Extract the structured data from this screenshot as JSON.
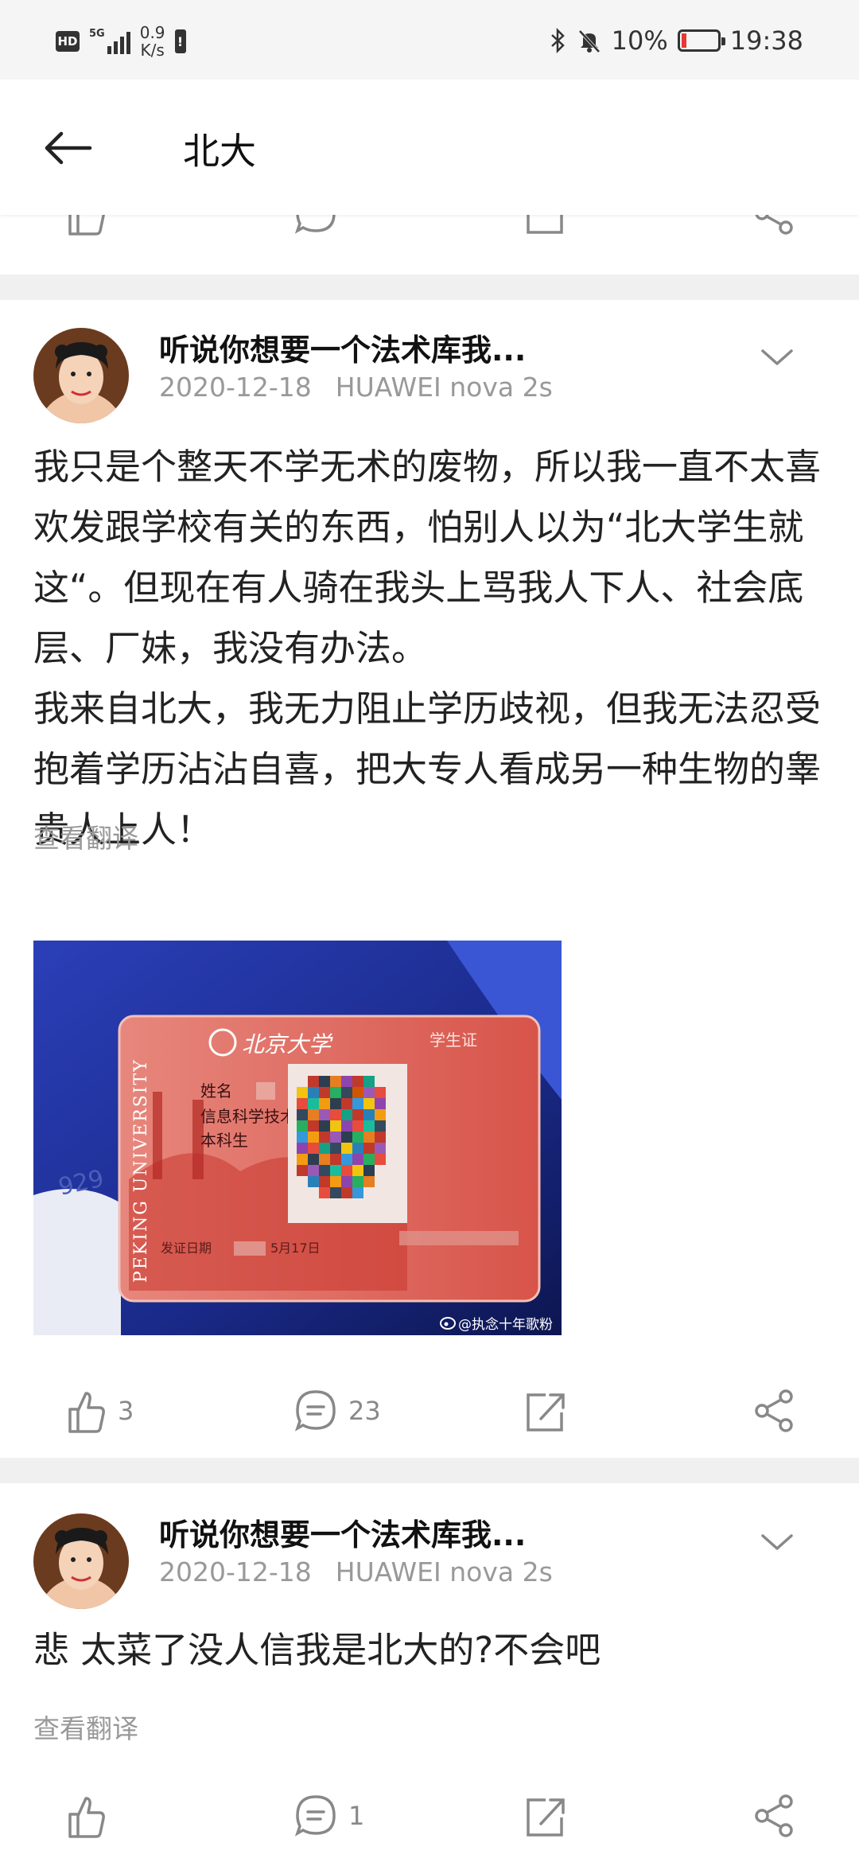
{
  "status_bar": {
    "hd": "HD",
    "network": "5G",
    "speed_value": "0.9",
    "speed_unit": "K/s",
    "battery_percent": "10%",
    "time": "19:38"
  },
  "app_bar": {
    "title": "北大"
  },
  "posts": [
    {
      "author": "听说你想要一个法术库我...",
      "date": "2020-12-18",
      "device": "HUAWEI nova 2s",
      "text": "我只是个整天不学无术的废物，所以我一直不太喜欢发跟学校有关的东西，怕别人以为“北大学生就这“。但现在有人骑在我头上骂我人下人、社会底层、厂妹，我没有办法。\n我来自北大，我无力阻止学历歧视，但我无法忍受抱着学历沾沾自喜，把大专人看成另一种生物的睾贵人上人！",
      "translate": "查看翻译",
      "image": {
        "card_title": "北京大学",
        "card_tag": "学生证",
        "card_english": "PEKING UNIVERSITY",
        "name_label": "姓名",
        "school": "信息科学技术学院",
        "degree": "本科生",
        "issue_label": "发证日期",
        "issue_date_fragment": "5月17日",
        "background_number": "929",
        "watermark": "@执念十年歌粉"
      },
      "likes": "3",
      "comments": "23"
    },
    {
      "author": "听说你想要一个法术库我...",
      "date": "2020-12-18",
      "device": "HUAWEI nova 2s",
      "text": "悲 太菜了没人信我是北大的?不会吧",
      "translate": "查看翻译",
      "likes": "",
      "comments": "1"
    }
  ],
  "colors": {
    "status_bg": "#f5f5f5",
    "separator": "#f0f0f0",
    "muted_text": "#999999",
    "icon_gray": "#888888",
    "card_red": "#d9473f",
    "card_blue": "#1b2a8c"
  },
  "icons": [
    "back-arrow-icon",
    "like-icon",
    "comment-icon",
    "repost-icon",
    "share-icon",
    "chevron-down-icon",
    "bluetooth-icon",
    "mute-bell-icon",
    "weibo-icon"
  ]
}
